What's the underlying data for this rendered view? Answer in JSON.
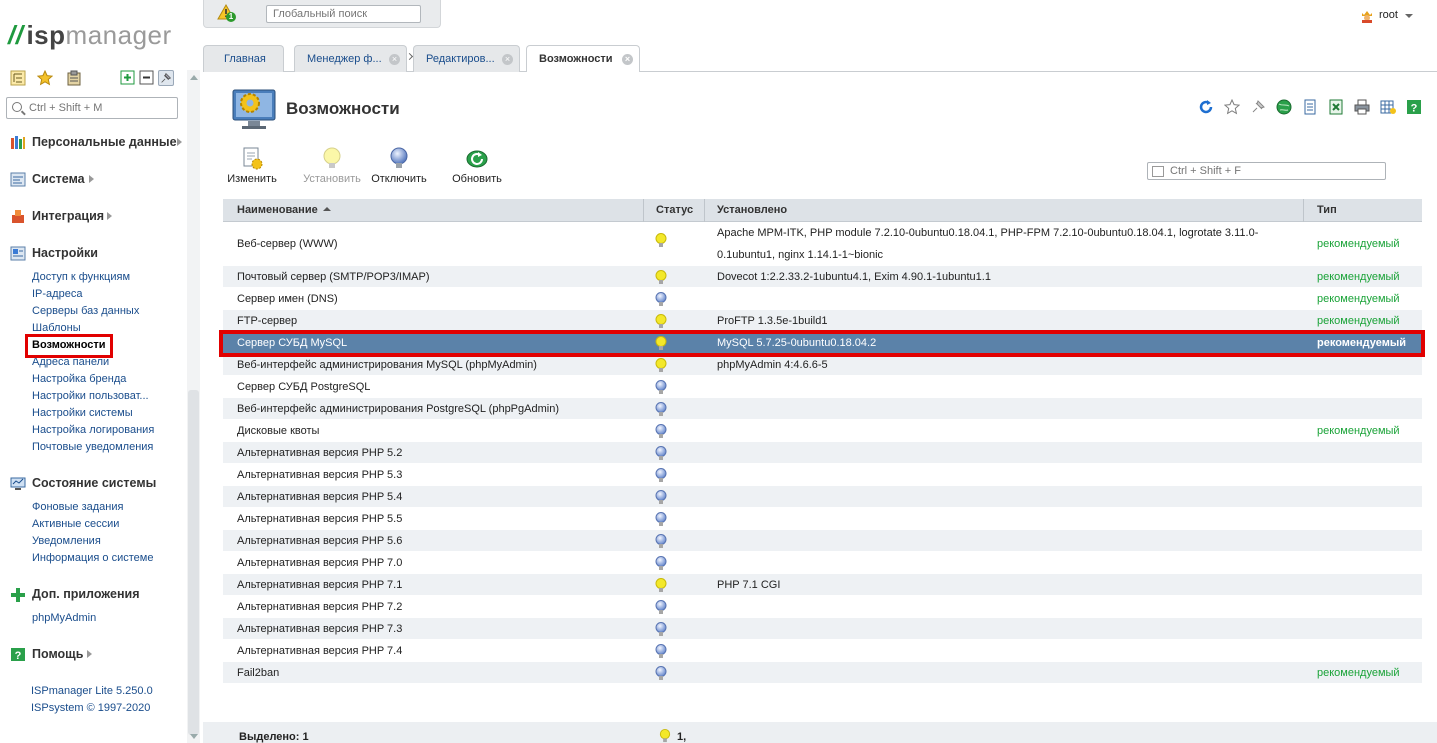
{
  "brand": {
    "logo_bars": "//",
    "logo_isp": "isp",
    "logo_manager": "manager"
  },
  "sidebar": {
    "search_placeholder": "Ctrl + Shift + M",
    "sections": [
      {
        "label": "Персональные данные",
        "icon": "personal-data-icon"
      },
      {
        "label": "Система",
        "icon": "system-icon"
      },
      {
        "label": "Интеграция",
        "icon": "integration-icon"
      },
      {
        "label": "Настройки",
        "icon": "settings-icon"
      },
      {
        "label": "Состояние системы",
        "icon": "system-state-icon"
      },
      {
        "label": "Доп. приложения",
        "icon": "plus-icon"
      },
      {
        "label": "Помощь",
        "icon": "help-icon"
      }
    ],
    "settings_items": [
      "Доступ к функциям",
      "IP-адреса",
      "Серверы баз данных",
      "Шаблоны",
      "Возможности",
      "Адреса панели",
      "Настройка бренда",
      "Настройки пользоват...",
      "Настройки системы",
      "Настройка логирования",
      "Почтовые уведомления"
    ],
    "state_items": [
      "Фоновые задания",
      "Активные сессии",
      "Уведомления",
      "Информация о системе"
    ],
    "apps_items": [
      "phpMyAdmin"
    ],
    "version_line1": "ISPmanager Lite 5.250.0",
    "version_line2": "ISPsystem © 1997-2020"
  },
  "topbar": {
    "warning_count": "1",
    "global_search_placeholder": "Глобальный поиск",
    "user": "root"
  },
  "tabs": [
    {
      "label": "Главная",
      "closable": false
    },
    {
      "label": "Менеджер ф...",
      "closable": true
    },
    {
      "label": "Редактиров...",
      "closable": true
    },
    {
      "label": "Возможности",
      "closable": true,
      "active": true
    }
  ],
  "page": {
    "title": "Возможности",
    "actions": [
      {
        "label": "Изменить",
        "icon": "edit-icon",
        "enabled": true
      },
      {
        "label": "Установить",
        "icon": "install-bulb-icon",
        "enabled": false
      },
      {
        "label": "Отключить",
        "icon": "disable-bulb-icon",
        "enabled": true
      },
      {
        "label": "Обновить",
        "icon": "refresh-icon",
        "enabled": true
      }
    ],
    "filter_placeholder": "Ctrl + Shift + F"
  },
  "table": {
    "columns": {
      "name": "Наименование",
      "status": "Статус",
      "installed": "Установлено",
      "type": "Тип"
    },
    "rows": [
      {
        "name": "Веб-сервер (WWW)",
        "status": "on",
        "installed": "Apache MPM-ITK, PHP module 7.2.10-0ubuntu0.18.04.1, PHP-FPM 7.2.10-0ubuntu0.18.04.1, logrotate 3.11.0-0.1ubuntu1, nginx 1.14.1-1~bionic",
        "type": "рекомендуемый"
      },
      {
        "name": "Почтовый сервер (SMTP/POP3/IMAP)",
        "status": "on",
        "installed": "Dovecot 1:2.2.33.2-1ubuntu4.1, Exim 4.90.1-1ubuntu1.1",
        "type": "рекомендуемый"
      },
      {
        "name": "Сервер имен (DNS)",
        "status": "off",
        "installed": "",
        "type": "рекомендуемый"
      },
      {
        "name": "FTP-сервер",
        "status": "on",
        "installed": "ProFTP 1.3.5e-1build1",
        "type": "рекомендуемый"
      },
      {
        "name": "Сервер СУБД MySQL",
        "status": "on",
        "installed": "MySQL 5.7.25-0ubuntu0.18.04.2",
        "type": "рекомендуемый",
        "selected": true
      },
      {
        "name": "Веб-интерфейс администрирования MySQL (phpMyAdmin)",
        "status": "on",
        "installed": "phpMyAdmin 4:4.6.6-5",
        "type": ""
      },
      {
        "name": "Сервер СУБД PostgreSQL",
        "status": "off",
        "installed": "",
        "type": ""
      },
      {
        "name": "Веб-интерфейс администрирования PostgreSQL (phpPgAdmin)",
        "status": "off",
        "installed": "",
        "type": ""
      },
      {
        "name": "Дисковые квоты",
        "status": "off",
        "installed": "",
        "type": "рекомендуемый"
      },
      {
        "name": "Альтернативная версия PHP 5.2",
        "status": "off",
        "installed": "",
        "type": ""
      },
      {
        "name": "Альтернативная версия PHP 5.3",
        "status": "off",
        "installed": "",
        "type": ""
      },
      {
        "name": "Альтернативная версия PHP 5.4",
        "status": "off",
        "installed": "",
        "type": ""
      },
      {
        "name": "Альтернативная версия PHP 5.5",
        "status": "off",
        "installed": "",
        "type": ""
      },
      {
        "name": "Альтернативная версия PHP 5.6",
        "status": "off",
        "installed": "",
        "type": ""
      },
      {
        "name": "Альтернативная версия PHP 7.0",
        "status": "off",
        "installed": "",
        "type": ""
      },
      {
        "name": "Альтернативная версия PHP 7.1",
        "status": "on",
        "installed": "PHP 7.1 CGI",
        "type": ""
      },
      {
        "name": "Альтернативная версия PHP 7.2",
        "status": "off",
        "installed": "",
        "type": ""
      },
      {
        "name": "Альтернативная версия PHP 7.3",
        "status": "off",
        "installed": "",
        "type": ""
      },
      {
        "name": "Альтернативная версия PHP 7.4",
        "status": "off",
        "installed": "",
        "type": ""
      },
      {
        "name": "Fail2ban",
        "status": "off",
        "installed": "",
        "type": "рекомендуемый"
      }
    ]
  },
  "footer": {
    "selected_label": "Выделено: 1",
    "selected_count": "1,"
  },
  "colors": {
    "brand_green": "#1f9a3f",
    "link_blue": "#1a4d8c",
    "recommended_green": "#1aa338",
    "selected_row": "#5b82a9",
    "highlight_red": "#e10000",
    "bulb_on": "#f3e82a",
    "bulb_off": "#7f9fd6"
  }
}
